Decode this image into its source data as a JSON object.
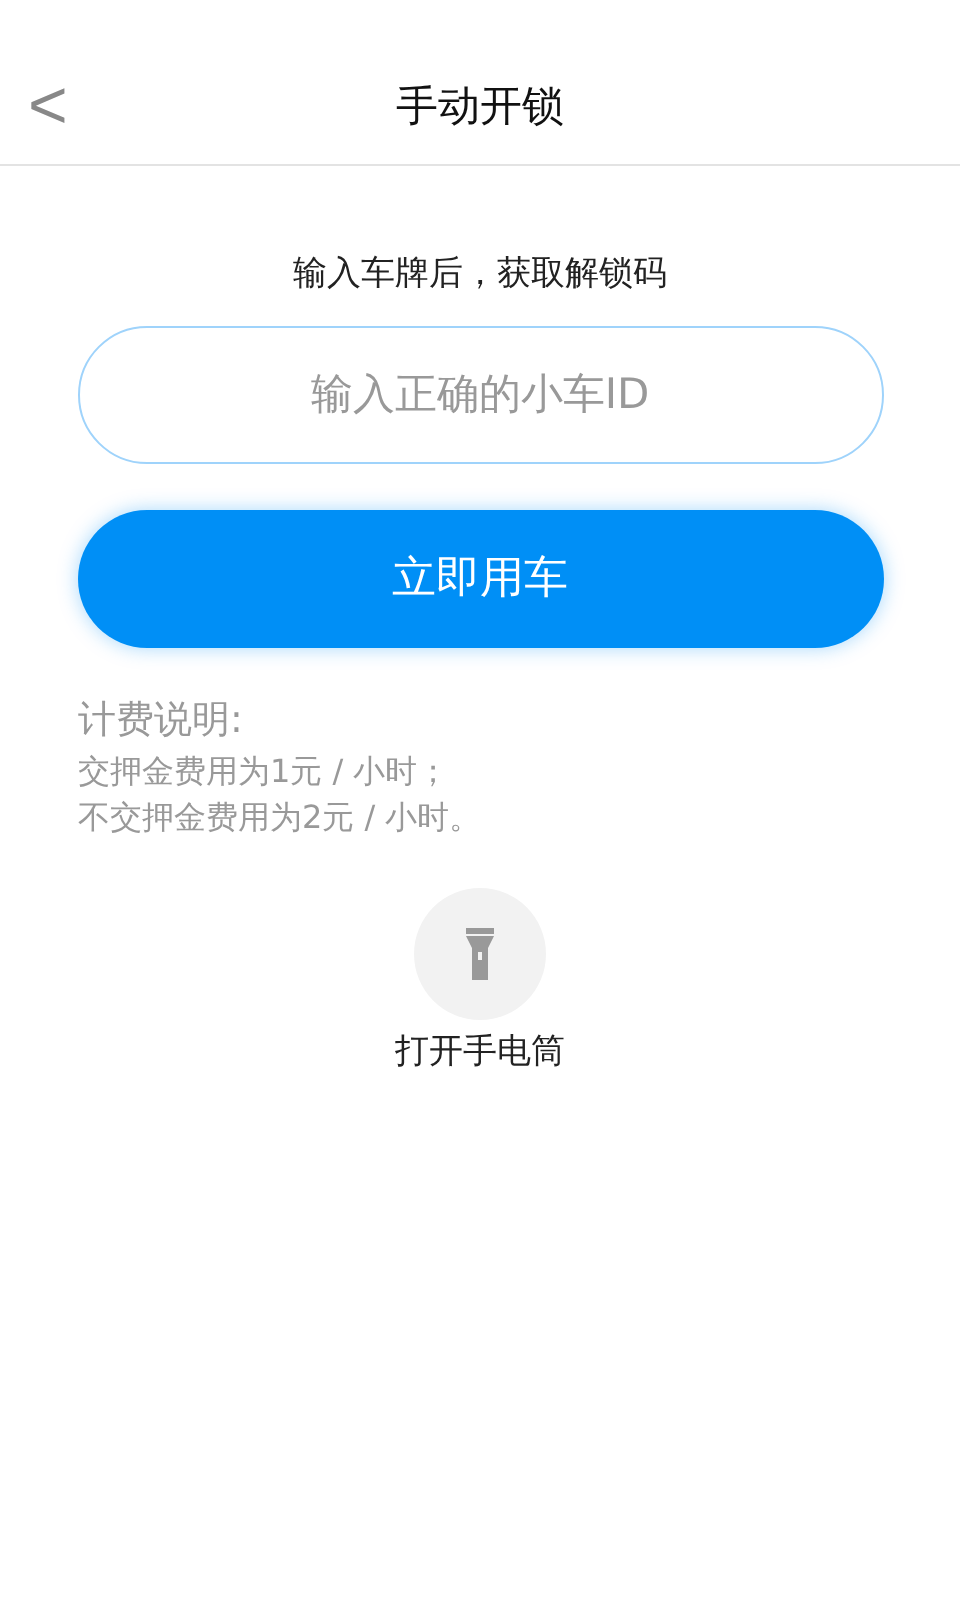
{
  "header": {
    "back": "<",
    "title": "手动开锁"
  },
  "hint": "输入车牌后，获取解锁码",
  "id_field": {
    "placeholder": "输入正确的小车ID"
  },
  "submit": "立即用车",
  "pricing": {
    "title": "计费说明:",
    "lines": [
      "交押金费用为1元 / 小时；",
      "不交押金费用为2元 / 小时。"
    ]
  },
  "flashlight": {
    "label": "打开手电筒"
  }
}
